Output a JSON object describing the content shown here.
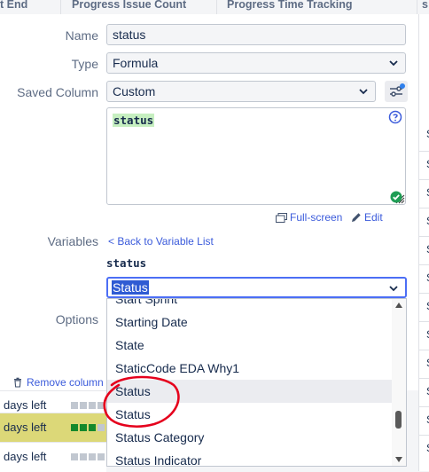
{
  "header": {
    "col1": "t End",
    "col2": "Progress Issue Count",
    "col3": "Progress Time Tracking",
    "col4": "s"
  },
  "right_column": {
    "letter": "S"
  },
  "background_rows": [
    {
      "text": "days left",
      "bars": [
        "e",
        "e",
        "e",
        "e"
      ]
    },
    {
      "text": "days left",
      "bars": [
        "g",
        "g",
        "g",
        "e"
      ]
    },
    {
      "text": "days left",
      "bars": [
        "e",
        "e",
        "e",
        "e"
      ]
    }
  ],
  "form": {
    "name_label": "Name",
    "name_value": "status",
    "type_label": "Type",
    "type_value": "Formula",
    "saved_label": "Saved Column",
    "saved_value": "Custom",
    "formula": "status",
    "fullscreen": "Full-screen",
    "edit": "Edit",
    "variables_label": "Variables",
    "back_link": "< Back to Variable List",
    "variable_name": "status",
    "variable_select_value": "Status",
    "options_label": "Options",
    "remove_column": "Remove column"
  },
  "dropdown_options": [
    "Start Sprint",
    "Starting Date",
    "State",
    "StaticCode EDA Why1",
    "Status",
    "Status",
    "Status Category",
    "Status Indicator"
  ],
  "colors": {
    "accent": "#3b5bdb",
    "highlight": "#c6efc0",
    "annotation": "#e5001c",
    "ok": "#1f9d55"
  },
  "icons": [
    "chevron-down-icon",
    "settings-sliders-icon",
    "help-icon",
    "check-circle-icon",
    "fullscreen-icon",
    "pencil-icon",
    "trash-icon",
    "resize-grip-icon"
  ]
}
